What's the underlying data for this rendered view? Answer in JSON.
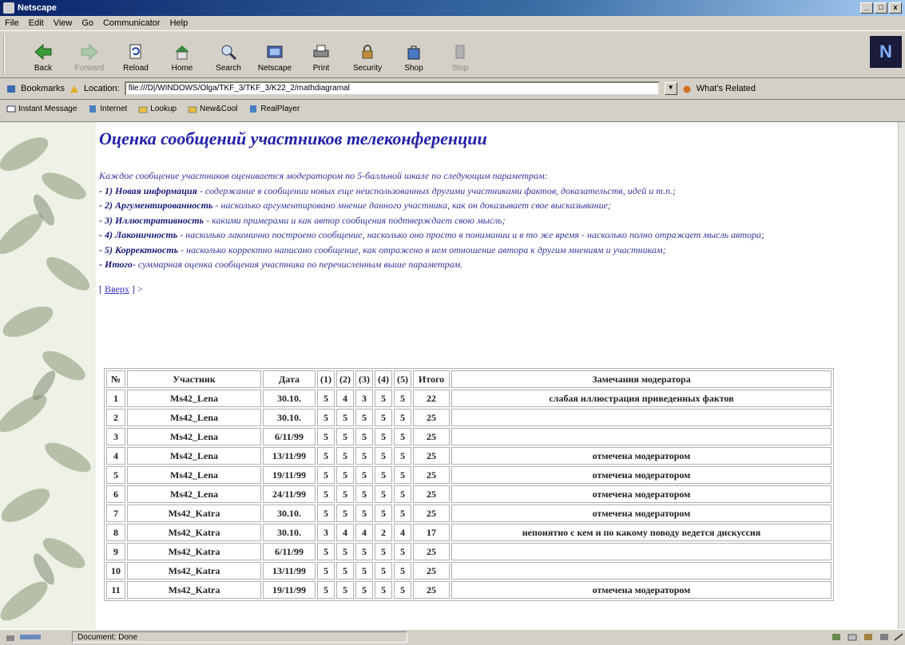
{
  "window": {
    "title": "Netscape",
    "min_label": "_",
    "max_label": "□",
    "close_label": "x"
  },
  "menu": [
    "File",
    "Edit",
    "View",
    "Go",
    "Communicator",
    "Help"
  ],
  "toolbar": [
    {
      "label": "Back",
      "icon": "back-arrow-icon",
      "enabled": true
    },
    {
      "label": "Forward",
      "icon": "forward-arrow-icon",
      "enabled": false
    },
    {
      "label": "Reload",
      "icon": "reload-icon",
      "enabled": true
    },
    {
      "label": "Home",
      "icon": "home-icon",
      "enabled": true
    },
    {
      "label": "Search",
      "icon": "search-icon",
      "enabled": true
    },
    {
      "label": "Netscape",
      "icon": "netscape-icon",
      "enabled": true
    },
    {
      "label": "Print",
      "icon": "print-icon",
      "enabled": true
    },
    {
      "label": "Security",
      "icon": "security-lock-icon",
      "enabled": true
    },
    {
      "label": "Shop",
      "icon": "shop-bag-icon",
      "enabled": true
    },
    {
      "label": "Stop",
      "icon": "stop-icon",
      "enabled": false
    }
  ],
  "location": {
    "bookmarks_label": "Bookmarks",
    "location_label": "Location:",
    "url": "file:///D|/WINDOWS/Olga/TKF_3/TKF_3/K22_2/mathdiagramal",
    "whats_related": "What's Related"
  },
  "personal": [
    "Instant Message",
    "Internet",
    "Lookup",
    "New&Cool",
    "RealPlayer"
  ],
  "page": {
    "title": "Оценка сообщений участников телеконференции",
    "intro": "Каждое сообщение участников оценивается модератором по 5-балльной шкале по следующим параметрам:",
    "criteria": [
      {
        "name": "- 1) Новая информация",
        "text": " - содержание в сообщении новых еще неиспользованных другими участниками фактов, доказательств, идей и т.п.;"
      },
      {
        "name": "- 2) Аргументированность",
        "text": " - насколько аргументировано мнение данного участника, как он доказывает свое высказывание;"
      },
      {
        "name": "- 3) Иллюстративность",
        "text": " - какими примерами и как автор сообщения подтверждает свою мысль;"
      },
      {
        "name": "- 4) Лаконичность",
        "text": " - насколько лаконично построено сообщение, насколько оно просто в понимании и в то же время - насколько полно отражает мысль автора;"
      },
      {
        "name": "- 5) Корректность",
        "text": " - насколько корректно написано сообщение, как отражено в нем отношение автора к другим мнениям и участникам;"
      },
      {
        "name": "- Итого",
        "text": "- суммарная оценка сообщения участника по перечисленным выше параметрам."
      }
    ],
    "back_link": "Вверх",
    "back_sep": "[ ",
    "back_end": " ] >"
  },
  "table": {
    "headers": [
      "№",
      "Участник",
      "Дата",
      "(1)",
      "(2)",
      "(3)",
      "(4)",
      "(5)",
      "Итого",
      "Замечания модератора"
    ],
    "rows": [
      [
        "1",
        "Ms42_Lena",
        "30.10.",
        "5",
        "4",
        "3",
        "5",
        "5",
        "22",
        "слабая иллюстрация приведенных фактов"
      ],
      [
        "2",
        "Ms42_Lena",
        "30.10.",
        "5",
        "5",
        "5",
        "5",
        "5",
        "25",
        ""
      ],
      [
        "3",
        "Ms42_Lena",
        "6/11/99",
        "5",
        "5",
        "5",
        "5",
        "5",
        "25",
        ""
      ],
      [
        "4",
        "Ms42_Lena",
        "13/11/99",
        "5",
        "5",
        "5",
        "5",
        "5",
        "25",
        "отмечена модератором"
      ],
      [
        "5",
        "Ms42_Lena",
        "19/11/99",
        "5",
        "5",
        "5",
        "5",
        "5",
        "25",
        "отмечена модератором"
      ],
      [
        "6",
        "Ms42_Lena",
        "24/11/99",
        "5",
        "5",
        "5",
        "5",
        "5",
        "25",
        "отмечена модератором"
      ],
      [
        "7",
        "Ms42_Katra",
        "30.10.",
        "5",
        "5",
        "5",
        "5",
        "5",
        "25",
        "отмечена модератором"
      ],
      [
        "8",
        "Ms42_Katra",
        "30.10.",
        "3",
        "4",
        "4",
        "2",
        "4",
        "17",
        "непонятно с кем и по какому поводу ведется дискуссия"
      ],
      [
        "9",
        "Ms42_Katra",
        "6/11/99",
        "5",
        "5",
        "5",
        "5",
        "5",
        "25",
        ""
      ],
      [
        "10",
        "Ms42_Katra",
        "13/11/99",
        "5",
        "5",
        "5",
        "5",
        "5",
        "25",
        ""
      ],
      [
        "11",
        "Ms42_Katra",
        "19/11/99",
        "5",
        "5",
        "5",
        "5",
        "5",
        "25",
        "отмечена модератором"
      ]
    ]
  },
  "status": {
    "text": "Document: Done"
  },
  "colors": {
    "title_blue": "#2222aa",
    "text_blue": "#333399",
    "chrome_gray": "#d4d0c8"
  }
}
